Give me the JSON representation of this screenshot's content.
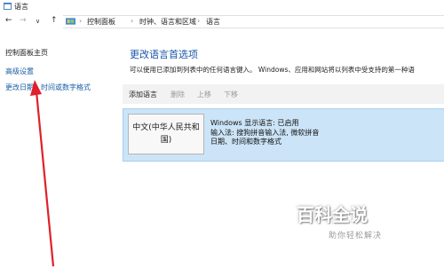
{
  "window": {
    "title": "语言"
  },
  "address": {
    "crumbs": [
      "控制面板",
      "时钟、语言和区域",
      "语言"
    ],
    "separator": "›"
  },
  "nav": {
    "back": "←",
    "forward": "→",
    "history": "∨",
    "up": "↑"
  },
  "sidebar": {
    "items": [
      {
        "label": "控制面板主页"
      },
      {
        "label": "高级设置"
      },
      {
        "label": "更改日期、时间或数字格式"
      }
    ]
  },
  "main": {
    "title": "更改语言首选项",
    "description": "可以使用已添加到列表中的任何语言键入。 Windows、应用和网站将以列表中受支持的第一种语",
    "toolbar": {
      "add": "添加语言",
      "delete": "删除",
      "up": "上移",
      "down": "下移"
    },
    "language": {
      "name": "中文(中华人民共和国)",
      "info": [
        "Windows 显示语言: 已启用",
        "输入法: 搜狗拼音输入法, 微软拼音",
        "日期、时间和数字格式"
      ]
    }
  },
  "watermark": {
    "main": "百科全说",
    "sub": "助你轻松解决"
  },
  "colors": {
    "link": "#1a5da6",
    "title": "#1a56a8",
    "selection": "#cce4f7",
    "arrow": "#e0202a"
  }
}
